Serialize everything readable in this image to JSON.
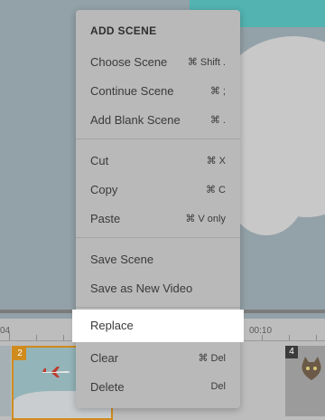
{
  "timeline": {
    "ruler_left": "04",
    "ruler_right": "00:10",
    "scene_badges": [
      "2",
      "4"
    ]
  },
  "menu": {
    "heading": "ADD SCENE",
    "items": [
      {
        "label": "Choose Scene",
        "shortcut": "⌘ Shift ."
      },
      {
        "label": "Continue Scene",
        "shortcut": "⌘ ;"
      },
      {
        "label": "Add Blank Scene",
        "shortcut": "⌘ ."
      },
      {
        "label": "Cut",
        "shortcut": "⌘ X"
      },
      {
        "label": "Copy",
        "shortcut": "⌘ C"
      },
      {
        "label": "Paste",
        "shortcut": "⌘ V only"
      },
      {
        "label": "Save Scene",
        "shortcut": ""
      },
      {
        "label": "Save as New Video",
        "shortcut": ""
      },
      {
        "label": "Replace",
        "shortcut": ""
      },
      {
        "label": "Clear",
        "shortcut": "⌘ Del"
      },
      {
        "label": "Delete",
        "shortcut": "Del"
      }
    ],
    "highlighted_item": "Replace"
  },
  "colors": {
    "selected_scene_border": "#d08b1d",
    "highlight_background": "#ffffff",
    "menu_background": "#b9b9b9"
  }
}
